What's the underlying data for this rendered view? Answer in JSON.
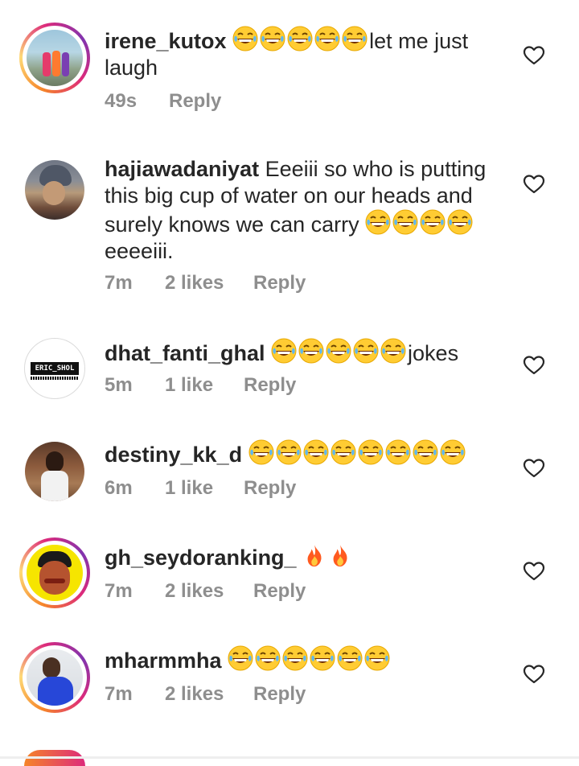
{
  "comments": [
    {
      "username": "irene_kutox",
      "emoji_before": "laughing-tears-emoji x5",
      "text": "let me just laugh",
      "time": "49s",
      "likes": "",
      "reply": "Reply",
      "story_ring": true
    },
    {
      "username": "hajiawadaniyat",
      "text_before": " Eeeiii so who is putting this big cup of water on our heads and surely knows we can carry ",
      "text_after": "eeeeiii.",
      "time": "7m",
      "likes": "2 likes",
      "reply": "Reply",
      "story_ring": false
    },
    {
      "username": "dhat_fanti_ghal",
      "text": "jokes",
      "time": "5m",
      "likes": "1 like",
      "reply": "Reply",
      "avatar_text": "ERIC_SHOL",
      "story_ring": false
    },
    {
      "username": "destiny_kk_d",
      "time": "6m",
      "likes": "1 like",
      "reply": "Reply",
      "story_ring": false
    },
    {
      "username": "gh_seydoranking_",
      "time": "7m",
      "likes": "2 likes",
      "reply": "Reply",
      "story_ring": true
    },
    {
      "username": "mharmmha",
      "time": "7m",
      "likes": "2 likes",
      "reply": "Reply",
      "story_ring": true
    }
  ],
  "colors": {
    "text": "#262626",
    "meta": "#8e8e8e",
    "emoji_face": "#ffcc33",
    "fire": "#ff5a1f"
  },
  "icons": [
    "heart-outline-icon",
    "laughing-tears-emoji",
    "fire-emoji"
  ]
}
